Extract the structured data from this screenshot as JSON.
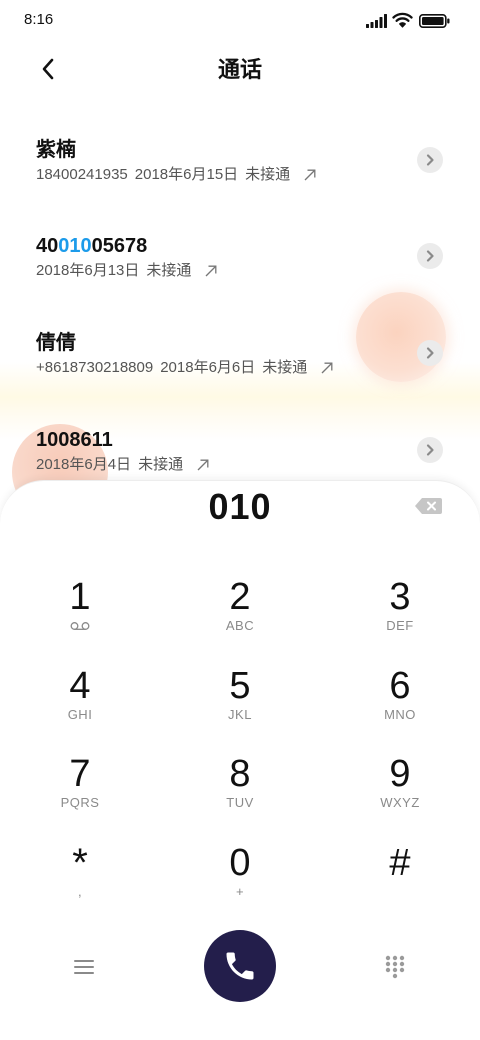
{
  "status_bar": {
    "time": "8:16",
    "icons": {
      "signal": "signal-icon",
      "wifi": "wifi-icon",
      "battery": "battery-icon"
    }
  },
  "header": {
    "title": "通话",
    "back_icon": "back-chevron-icon"
  },
  "calls": [
    {
      "name": "紫楠",
      "number": "18400241935",
      "date": "2018年6月15日",
      "status": "未接通",
      "direction_icon": "outgoing-arrow-icon",
      "info_icon": "chevron-right-icon"
    },
    {
      "name_parts": {
        "before": "40",
        "match": "010",
        "after": "05678"
      },
      "date": "2018年6月13日",
      "status": "未接通",
      "direction_icon": "outgoing-arrow-icon",
      "info_icon": "chevron-right-icon"
    },
    {
      "name": "倩倩",
      "number": "+8618730218809",
      "date": "2018年6月6日",
      "status": "未接通",
      "direction_icon": "outgoing-arrow-icon",
      "info_icon": "chevron-right-icon"
    },
    {
      "name": "1008611",
      "date": "2018年6月4日",
      "status": "未接通",
      "direction_icon": "outgoing-arrow-icon",
      "info_icon": "chevron-right-icon"
    }
  ],
  "dialpad": {
    "input_value": "010",
    "backspace_icon": "backspace-icon",
    "keys": [
      {
        "digit": "1",
        "sub_icon": "voicemail-icon"
      },
      {
        "digit": "2",
        "letters": "ABC"
      },
      {
        "digit": "3",
        "letters": "DEF"
      },
      {
        "digit": "4",
        "letters": "GHI"
      },
      {
        "digit": "5",
        "letters": "JKL"
      },
      {
        "digit": "6",
        "letters": "MNO"
      },
      {
        "digit": "7",
        "letters": "PQRS"
      },
      {
        "digit": "8",
        "letters": "TUV"
      },
      {
        "digit": "9",
        "letters": "WXYZ"
      },
      {
        "digit": "*",
        "letters": ","
      },
      {
        "digit": "0",
        "letters": "+"
      },
      {
        "digit": "#"
      }
    ]
  },
  "bottom_bar": {
    "menu_icon": "menu-icon",
    "call_icon": "phone-icon",
    "keypad_icon": "dialpad-icon"
  },
  "colors": {
    "match_highlight": "#1c9bea",
    "call_button": "#231e4b",
    "text_primary": "#111111",
    "text_secondary": "#555555",
    "key_letters": "#8a8a8a"
  }
}
